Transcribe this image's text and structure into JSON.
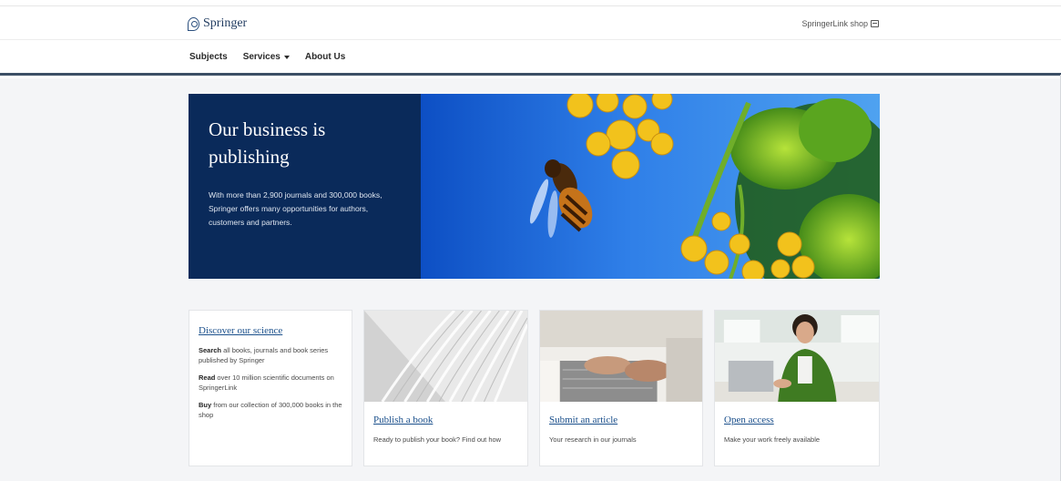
{
  "header": {
    "logo_text": "Springer",
    "shop_label": "SpringerLink shop",
    "shop_icon": "cart-icon"
  },
  "nav": {
    "items": [
      {
        "label": "Subjects"
      },
      {
        "label": "Services"
      },
      {
        "label": "About Us"
      }
    ]
  },
  "hero": {
    "title": "Our business is publishing",
    "description": "With more than 2,900 journals and 300,000 books, Springer offers many opportunities for authors, customers and partners."
  },
  "discover": {
    "link": "Discover our science",
    "search_bold": "Search",
    "search_text": " all books, journals and book series published by Springer",
    "read_bold": "Read",
    "read_text": " over 10 million scientific documents on SpringerLink",
    "buy_bold": "Buy",
    "buy_text": " from our collection of 300,000 books in the shop"
  },
  "cards": [
    {
      "link": "Publish a book",
      "text": "Ready to publish your book? Find out how"
    },
    {
      "link": "Submit an article",
      "text": "Your research in our journals"
    },
    {
      "link": "Open access",
      "text": "Make your work freely available"
    }
  ],
  "colors": {
    "hero_panel": "#0a2a5a",
    "link": "#1a4f8b",
    "nav_rule": "#3c4f65"
  }
}
